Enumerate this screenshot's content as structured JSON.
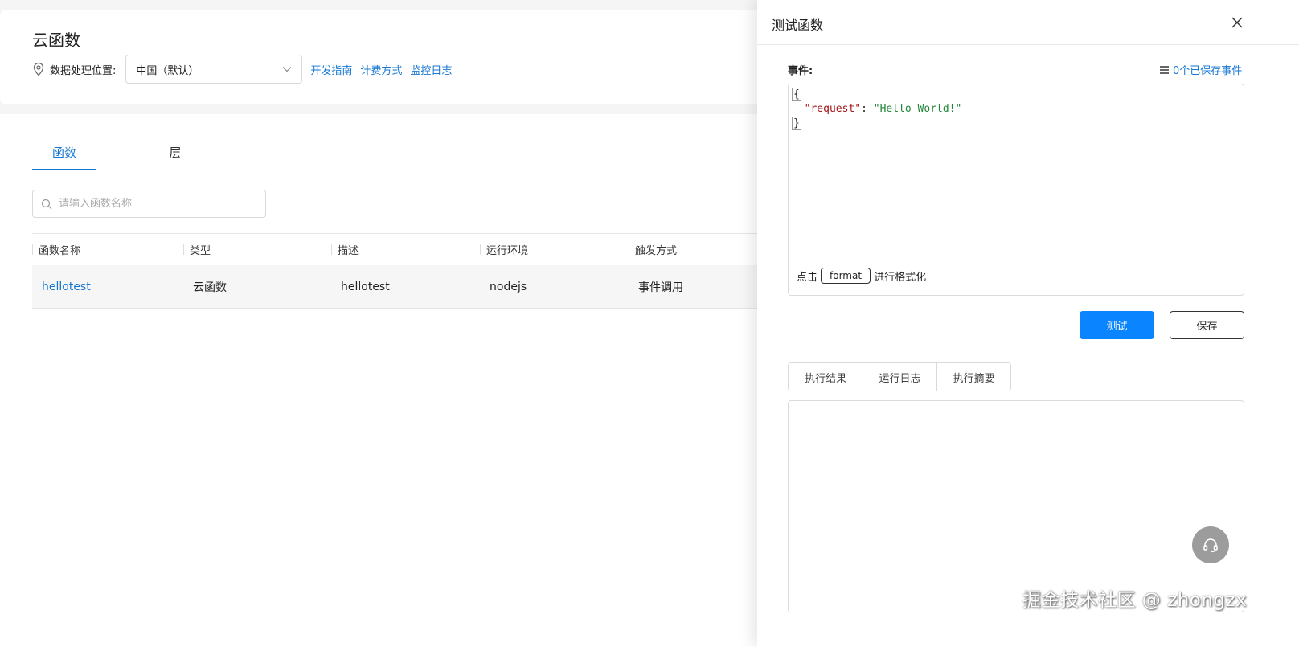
{
  "page": {
    "title": "云函数"
  },
  "location": {
    "label": "数据处理位置:",
    "region_value": "中国（默认）",
    "links": [
      "开发指南",
      "计费方式",
      "监控日志"
    ]
  },
  "tabs": [
    {
      "label": "函数",
      "active": true
    },
    {
      "label": "层",
      "active": false
    }
  ],
  "search": {
    "placeholder": "请输入函数名称"
  },
  "table": {
    "columns": [
      "函数名称",
      "类型",
      "描述",
      "运行环境",
      "触发方式"
    ],
    "rows": [
      {
        "name": "hellotest",
        "type": "云函数",
        "desc": "hellotest",
        "runtime": "nodejs",
        "trigger": "事件调用"
      }
    ]
  },
  "drawer": {
    "title": "测试函数",
    "event_label": "事件:",
    "saved_events": "0个已保存事件",
    "editor": {
      "open_brace": "{",
      "key": "\"request\"",
      "colon": ": ",
      "value": "\"Hello World!\"",
      "close_brace": "}"
    },
    "format_prefix": "点击",
    "format_button": "format",
    "format_suffix": "进行格式化",
    "test_button": "测试",
    "save_button": "保存",
    "result_tabs": [
      "执行结果",
      "运行日志",
      "执行摘要"
    ]
  },
  "watermark": "掘金技术社区 @ zhongzx",
  "colors": {
    "accent": "#1677d2",
    "primary_button": "#0a84ff"
  }
}
